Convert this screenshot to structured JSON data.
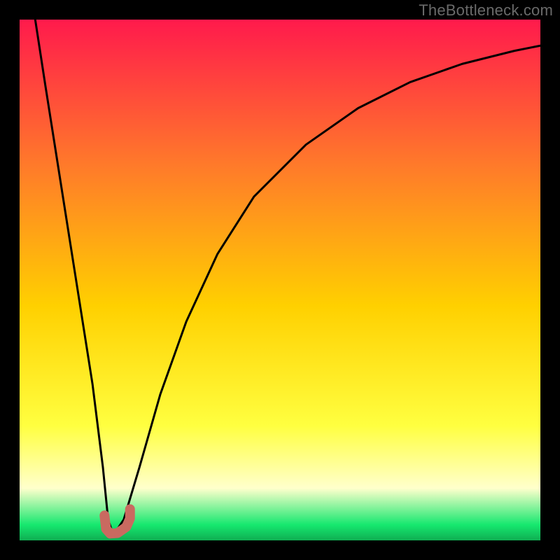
{
  "watermark": "TheBottleneck.com",
  "colors": {
    "frame": "#000000",
    "curve": "#000000",
    "marker": "#c96a60",
    "grad_top": "#ff1a4c",
    "grad_mid_upper": "#ff7a2a",
    "grad_mid": "#ffd000",
    "grad_mid_lower": "#ffff40",
    "grad_pale": "#ffffcc",
    "grad_green": "#16e86f"
  },
  "chart_data": {
    "type": "line",
    "title": "",
    "xlabel": "",
    "ylabel": "",
    "xlim": [
      0,
      100
    ],
    "ylim": [
      0,
      100
    ],
    "series": [
      {
        "name": "bottleneck-curve",
        "x": [
          3,
          5,
          8,
          11,
          14,
          16,
          17,
          18,
          20,
          23,
          27,
          32,
          38,
          45,
          55,
          65,
          75,
          85,
          95,
          100
        ],
        "y": [
          100,
          87,
          68,
          49,
          30,
          14,
          4,
          1,
          4,
          14,
          28,
          42,
          55,
          66,
          76,
          83,
          88,
          91.5,
          94,
          95
        ]
      }
    ],
    "marker": {
      "name": "optimal-point",
      "path_x": [
        16.3,
        16.6,
        17.4,
        18.8,
        20.5,
        21.2,
        21.2
      ],
      "path_y": [
        4.8,
        2.2,
        1.3,
        1.4,
        2.6,
        4.2,
        6.0
      ]
    }
  }
}
